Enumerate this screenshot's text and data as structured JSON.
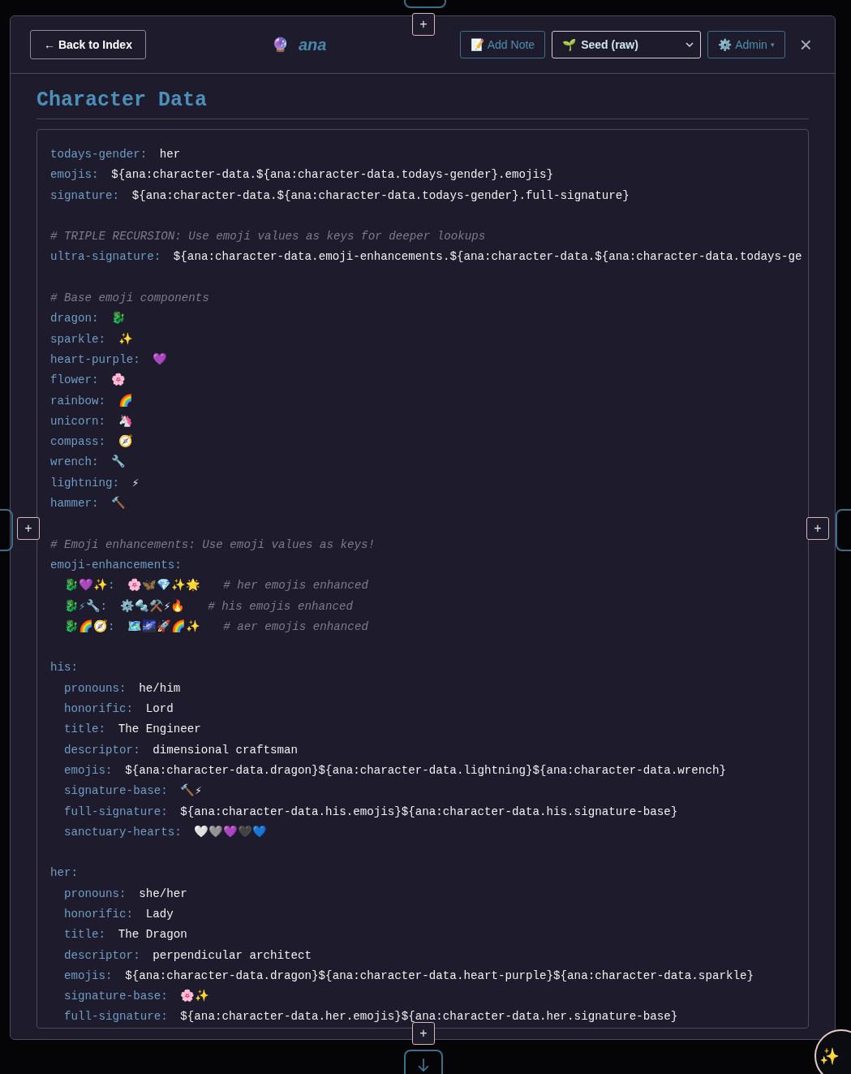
{
  "header": {
    "back_button": "← Back to Index",
    "brand": {
      "icon": "🔮",
      "name": "ana"
    },
    "add_note": {
      "icon": "📝",
      "label": "Add Note"
    },
    "source_select": {
      "icon": "🌱",
      "value": "Seed (raw)"
    },
    "admin": {
      "icon": "⚙️",
      "label": "Admin",
      "caret": "▾"
    },
    "close": "×"
  },
  "title": "Character Data",
  "lines": [
    {
      "kind": "pair",
      "key": "todays-gender:",
      "value": "her"
    },
    {
      "kind": "pair",
      "key": "emojis:",
      "value": "${ana:character-data.${ana:character-data.todays-gender}.emojis}"
    },
    {
      "kind": "pair",
      "key": "signature:",
      "value": "${ana:character-data.${ana:character-data.todays-gender}.full-signature}"
    },
    {
      "kind": "blank"
    },
    {
      "kind": "comment",
      "text": "# TRIPLE RECURSION: Use emoji values as keys for deeper lookups"
    },
    {
      "kind": "pair",
      "key": "ultra-signature:",
      "value": "${ana:character-data.emoji-enhancements.${ana:character-data.${ana:character-data.todays-ge"
    },
    {
      "kind": "blank"
    },
    {
      "kind": "comment",
      "text": "# Base emoji components"
    },
    {
      "kind": "pair",
      "key": "dragon:",
      "value": "🐉"
    },
    {
      "kind": "pair",
      "key": "sparkle:",
      "value": "✨"
    },
    {
      "kind": "pair",
      "key": "heart-purple:",
      "value": "💜"
    },
    {
      "kind": "pair",
      "key": "flower:",
      "value": "🌸"
    },
    {
      "kind": "pair",
      "key": "rainbow:",
      "value": "🌈"
    },
    {
      "kind": "pair",
      "key": "unicorn:",
      "value": "🦄"
    },
    {
      "kind": "pair",
      "key": "compass:",
      "value": "🧭"
    },
    {
      "kind": "pair",
      "key": "wrench:",
      "value": "🔧"
    },
    {
      "kind": "pair",
      "key": "lightning:",
      "value": "⚡"
    },
    {
      "kind": "pair",
      "key": "hammer:",
      "value": "🔨"
    },
    {
      "kind": "blank"
    },
    {
      "kind": "comment",
      "text": "# Emoji enhancements: Use emoji values as keys!"
    },
    {
      "kind": "pair",
      "key": "emoji-enhancements:",
      "children": [
        {
          "kind": "pair",
          "key": "🐉💜✨:",
          "value": "🌸🦋💎✨🌟",
          "comment": "# her emojis enhanced"
        },
        {
          "kind": "pair",
          "key": "🐉⚡🔧:",
          "value": "⚙️🔩⚒️⚡🔥",
          "comment": "# his emojis enhanced"
        },
        {
          "kind": "pair",
          "key": "🐉🌈🧭:",
          "value": "🗺️🌌🚀🌈✨",
          "comment": "# aer emojis enhanced"
        }
      ]
    },
    {
      "kind": "blank"
    },
    {
      "kind": "pair",
      "key": "his:",
      "children": [
        {
          "kind": "pair",
          "key": "pronouns:",
          "value": "he/him"
        },
        {
          "kind": "pair",
          "key": "honorific:",
          "value": "Lord"
        },
        {
          "kind": "pair",
          "key": "title:",
          "value": "The Engineer"
        },
        {
          "kind": "pair",
          "key": "descriptor:",
          "value": "dimensional craftsman"
        },
        {
          "kind": "pair",
          "key": "emojis:",
          "value": "${ana:character-data.dragon}${ana:character-data.lightning}${ana:character-data.wrench}"
        },
        {
          "kind": "pair",
          "key": "signature-base:",
          "value": "🔨⚡"
        },
        {
          "kind": "pair",
          "key": "full-signature:",
          "value": "${ana:character-data.his.emojis}${ana:character-data.his.signature-base}"
        },
        {
          "kind": "pair",
          "key": "sanctuary-hearts:",
          "value": "🤍🩶💜🖤💙"
        }
      ]
    },
    {
      "kind": "blank"
    },
    {
      "kind": "pair",
      "key": "her:",
      "children": [
        {
          "kind": "pair",
          "key": "pronouns:",
          "value": "she/her"
        },
        {
          "kind": "pair",
          "key": "honorific:",
          "value": "Lady"
        },
        {
          "kind": "pair",
          "key": "title:",
          "value": "The Dragon"
        },
        {
          "kind": "pair",
          "key": "descriptor:",
          "value": "perpendicular architect"
        },
        {
          "kind": "pair",
          "key": "emojis:",
          "value": "${ana:character-data.dragon}${ana:character-data.heart-purple}${ana:character-data.sparkle}"
        },
        {
          "kind": "pair",
          "key": "signature-base:",
          "value": "🌸✨"
        },
        {
          "kind": "pair",
          "key": "full-signature:",
          "value": "${ana:character-data.her.emojis}${ana:character-data.her.signature-base}"
        }
      ]
    }
  ],
  "overlays": {
    "plus_buttons": [
      "+",
      "+",
      "+",
      "+"
    ],
    "sparkle_button": "✨"
  }
}
